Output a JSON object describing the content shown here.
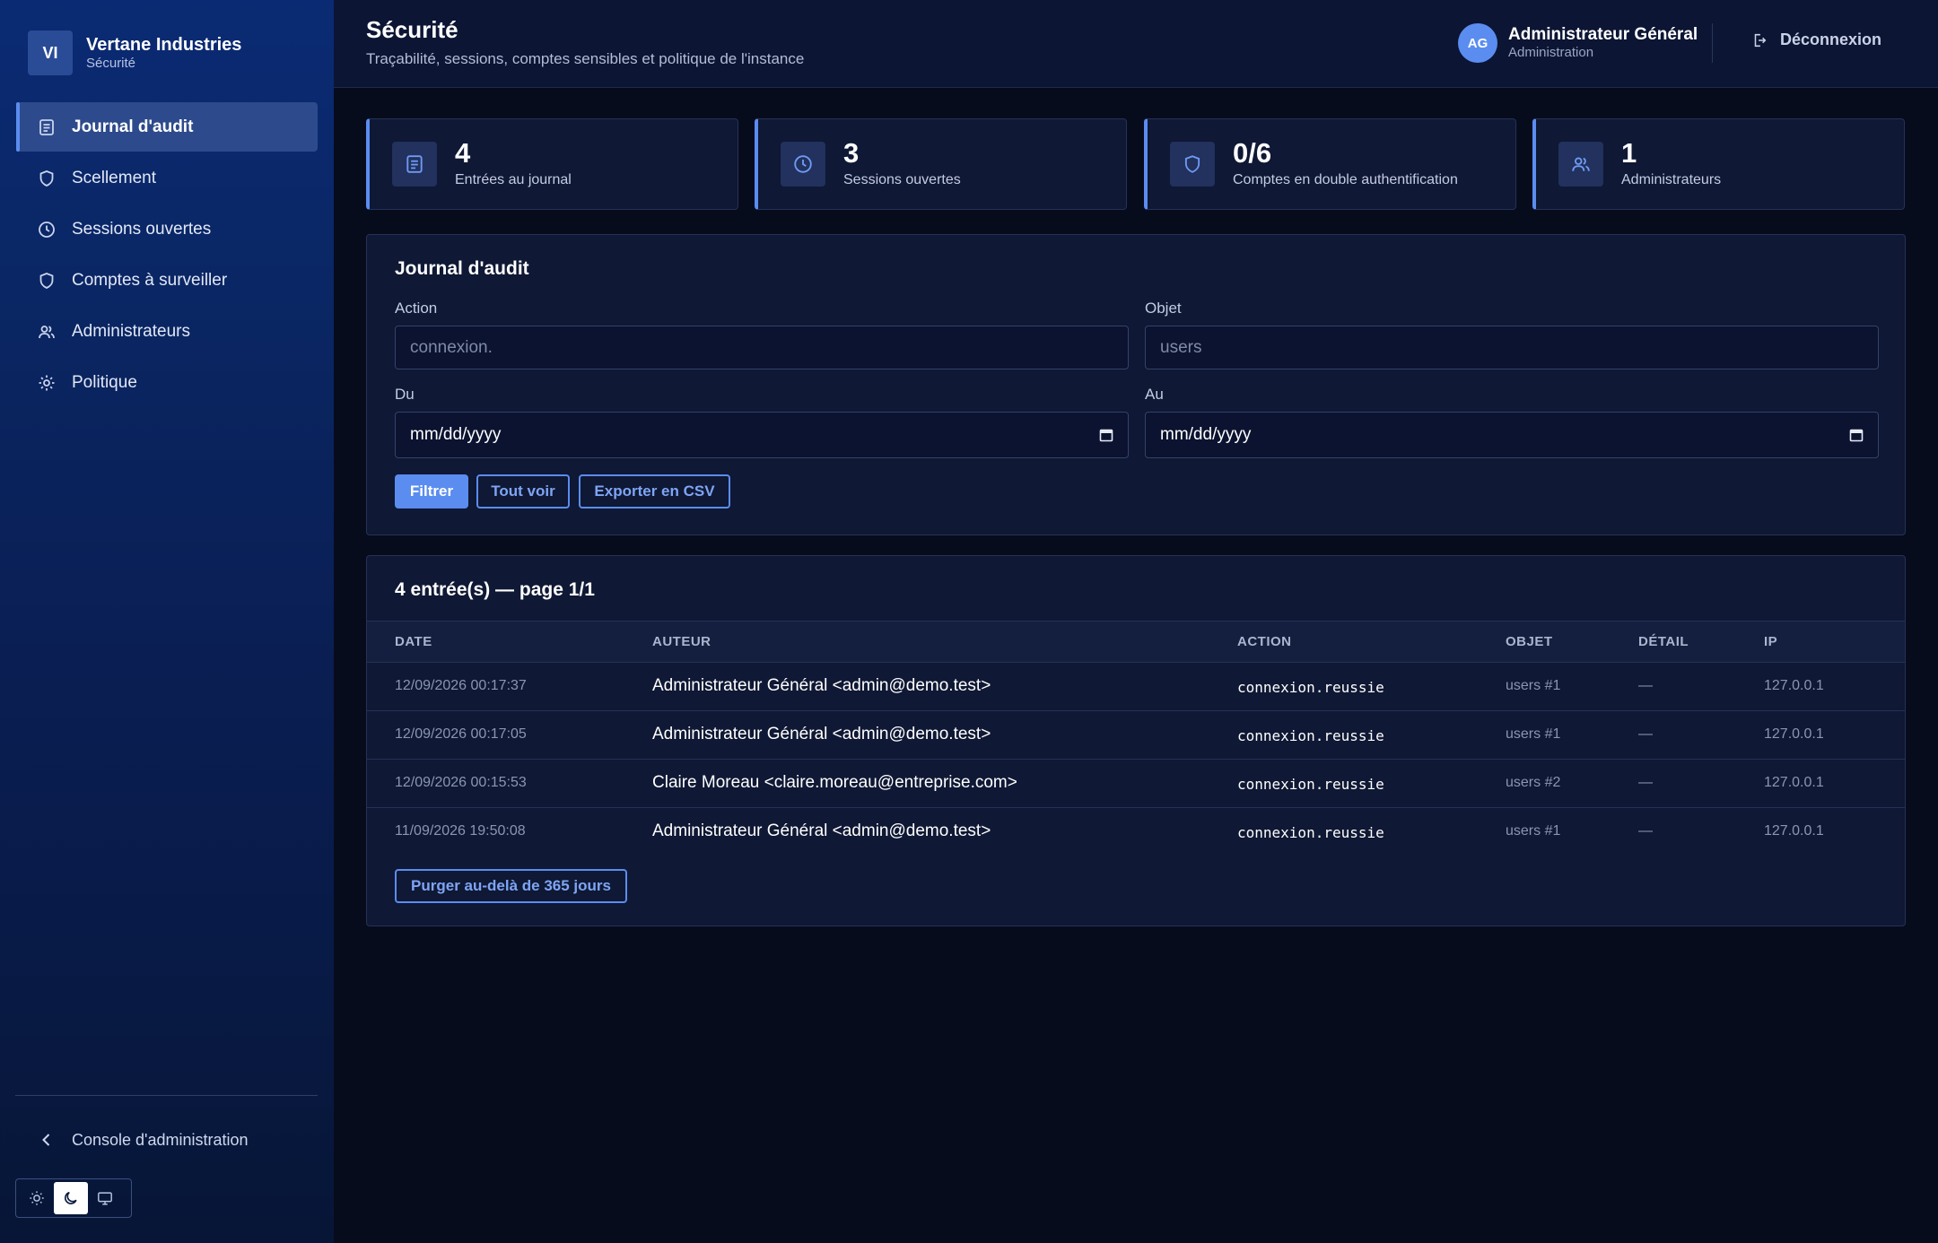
{
  "brand": {
    "initials": "VI",
    "name": "Vertane Industries",
    "section": "Sécurité"
  },
  "sidebar": {
    "items": [
      {
        "label": "Journal d'audit",
        "icon": "document-list-icon",
        "active": true
      },
      {
        "label": "Scellement",
        "icon": "shield-icon",
        "active": false
      },
      {
        "label": "Sessions ouvertes",
        "icon": "clock-icon",
        "active": false
      },
      {
        "label": "Comptes à surveiller",
        "icon": "shield-icon",
        "active": false
      },
      {
        "label": "Administrateurs",
        "icon": "users-icon",
        "active": false
      },
      {
        "label": "Politique",
        "icon": "gear-icon",
        "active": false
      }
    ],
    "console_link": "Console d'administration",
    "theme": {
      "options": [
        "sun-icon",
        "moon-icon",
        "monitor-icon"
      ],
      "selected": "moon-icon"
    }
  },
  "header": {
    "title": "Sécurité",
    "subtitle": "Traçabilité, sessions, comptes sensibles et politique de l'instance",
    "user": {
      "initials": "AG",
      "name": "Administrateur Général",
      "role": "Administration"
    },
    "logout_label": "Déconnexion"
  },
  "stats": [
    {
      "value": "4",
      "label": "Entrées au journal",
      "icon": "document-list-icon"
    },
    {
      "value": "3",
      "label": "Sessions ouvertes",
      "icon": "clock-icon"
    },
    {
      "value": "0/6",
      "label": "Comptes en double authentification",
      "icon": "shield-icon"
    },
    {
      "value": "1",
      "label": "Administrateurs",
      "icon": "users-icon"
    }
  ],
  "filters": {
    "title": "Journal d'audit",
    "action": {
      "label": "Action",
      "placeholder": "connexion."
    },
    "object": {
      "label": "Objet",
      "placeholder": "users"
    },
    "from": {
      "label": "Du",
      "value": "mm/dd/yyyy"
    },
    "to": {
      "label": "Au",
      "value": "mm/dd/yyyy"
    },
    "buttons": {
      "filter": "Filtrer",
      "show_all": "Tout voir",
      "export": "Exporter en CSV"
    }
  },
  "table": {
    "title": "4 entrée(s) — page 1/1",
    "columns": [
      "DATE",
      "AUTEUR",
      "ACTION",
      "OBJET",
      "DÉTAIL",
      "IP"
    ],
    "rows": [
      {
        "date": "12/09/2026 00:17:37",
        "author": "Administrateur Général <admin@demo.test>",
        "action": "connexion.reussie",
        "object": "users #1",
        "detail": "—",
        "ip": "127.0.0.1"
      },
      {
        "date": "12/09/2026 00:17:05",
        "author": "Administrateur Général <admin@demo.test>",
        "action": "connexion.reussie",
        "object": "users #1",
        "detail": "—",
        "ip": "127.0.0.1"
      },
      {
        "date": "12/09/2026 00:15:53",
        "author": "Claire Moreau <claire.moreau@entreprise.com>",
        "action": "connexion.reussie",
        "object": "users #2",
        "detail": "—",
        "ip": "127.0.0.1"
      },
      {
        "date": "11/09/2026 19:50:08",
        "author": "Administrateur Général <admin@demo.test>",
        "action": "connexion.reussie",
        "object": "users #1",
        "detail": "—",
        "ip": "127.0.0.1"
      }
    ],
    "purge_button": "Purger au-delà de 365 jours"
  },
  "colors": {
    "accent": "#5b8df0",
    "background": "#070c1d",
    "panel": "#0f1834",
    "sidebar": "#0a2a73"
  }
}
